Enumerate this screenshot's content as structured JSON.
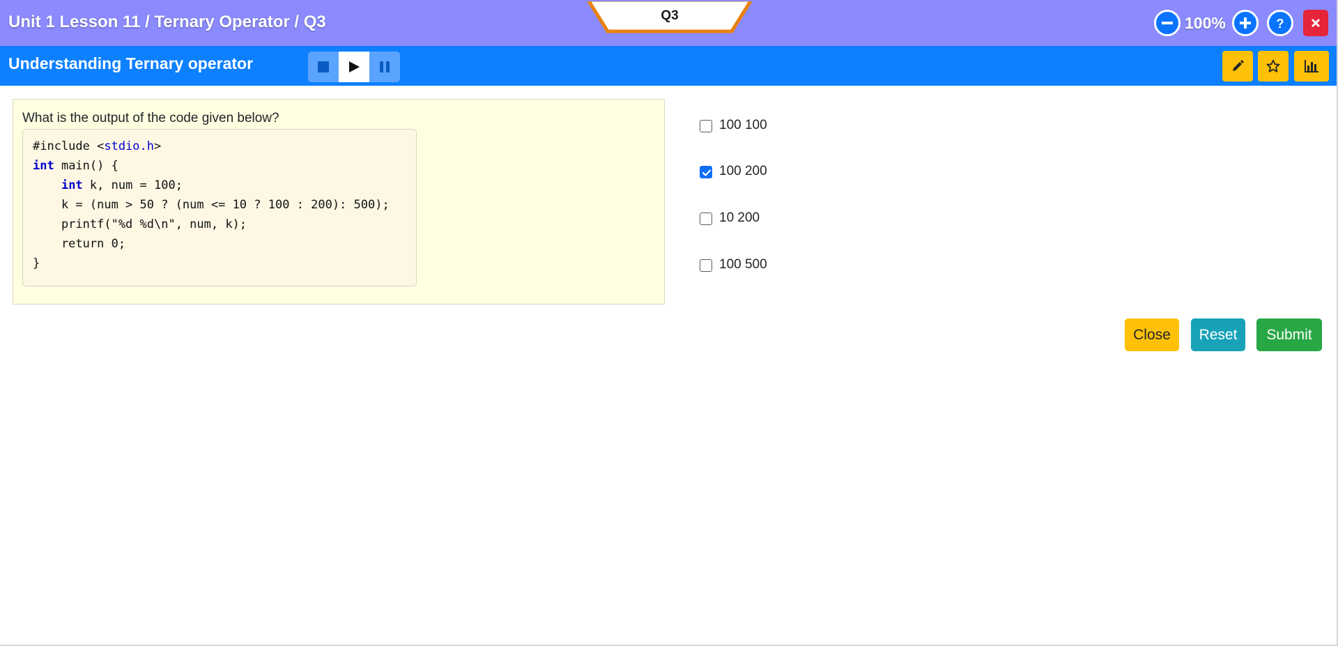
{
  "header": {
    "breadcrumb": "Unit 1 Lesson 11 / Ternary Operator / Q3",
    "question_tab": "Q3",
    "zoom_level": "100%",
    "colors": {
      "bar": "#8b8bff",
      "tab_outline": "#e8820c",
      "circle_buttons": "#0a74ff",
      "close": "#e5253a"
    },
    "icons": [
      "zoom-out-icon",
      "zoom-in-icon",
      "help-icon",
      "close-icon"
    ]
  },
  "subheader": {
    "title": "Understanding Ternary operator",
    "media_controls": [
      "stop-icon",
      "play-icon",
      "pause-icon"
    ],
    "active_media": "play",
    "tools": [
      "pencil-icon",
      "star-icon",
      "bar-chart-icon"
    ],
    "colors": {
      "bar": "#0c80ff",
      "tools": "#ffc107"
    }
  },
  "question": {
    "prompt": "What is the output of the code given below?",
    "code": [
      "#include <stdio.h>",
      "int main() {",
      "    int k, num = 100;",
      "    k = (num > 50 ? (num <= 10 ? 100 : 200): 500);",
      "    printf(\"%d %d\\n\", num, k);",
      "    return 0;",
      "}"
    ],
    "code_parts": {
      "l1_pre": "#include <",
      "l1_hdr": "stdio.h",
      "l1_post": ">",
      "l2_kw": "int",
      "l2_rest": " main() {",
      "l3_indent": "    ",
      "l3_kw": "int",
      "l3_rest": " k, num = 100;",
      "l4": "    k = (num > 50 ? (num <= 10 ? 100 : 200): 500);",
      "l5": "    printf(\"%d %d\\n\", num, k);",
      "l6": "    return 0;",
      "l7": "}"
    }
  },
  "options": [
    {
      "label": "100 100",
      "checked": false
    },
    {
      "label": "100 200",
      "checked": true
    },
    {
      "label": "10 200",
      "checked": false
    },
    {
      "label": "100 500",
      "checked": false
    }
  ],
  "actions": {
    "close_label": "Close",
    "reset_label": "Reset",
    "submit_label": "Submit",
    "colors": {
      "close": "#ffc107",
      "reset": "#17a2b8",
      "submit": "#28a745"
    }
  }
}
